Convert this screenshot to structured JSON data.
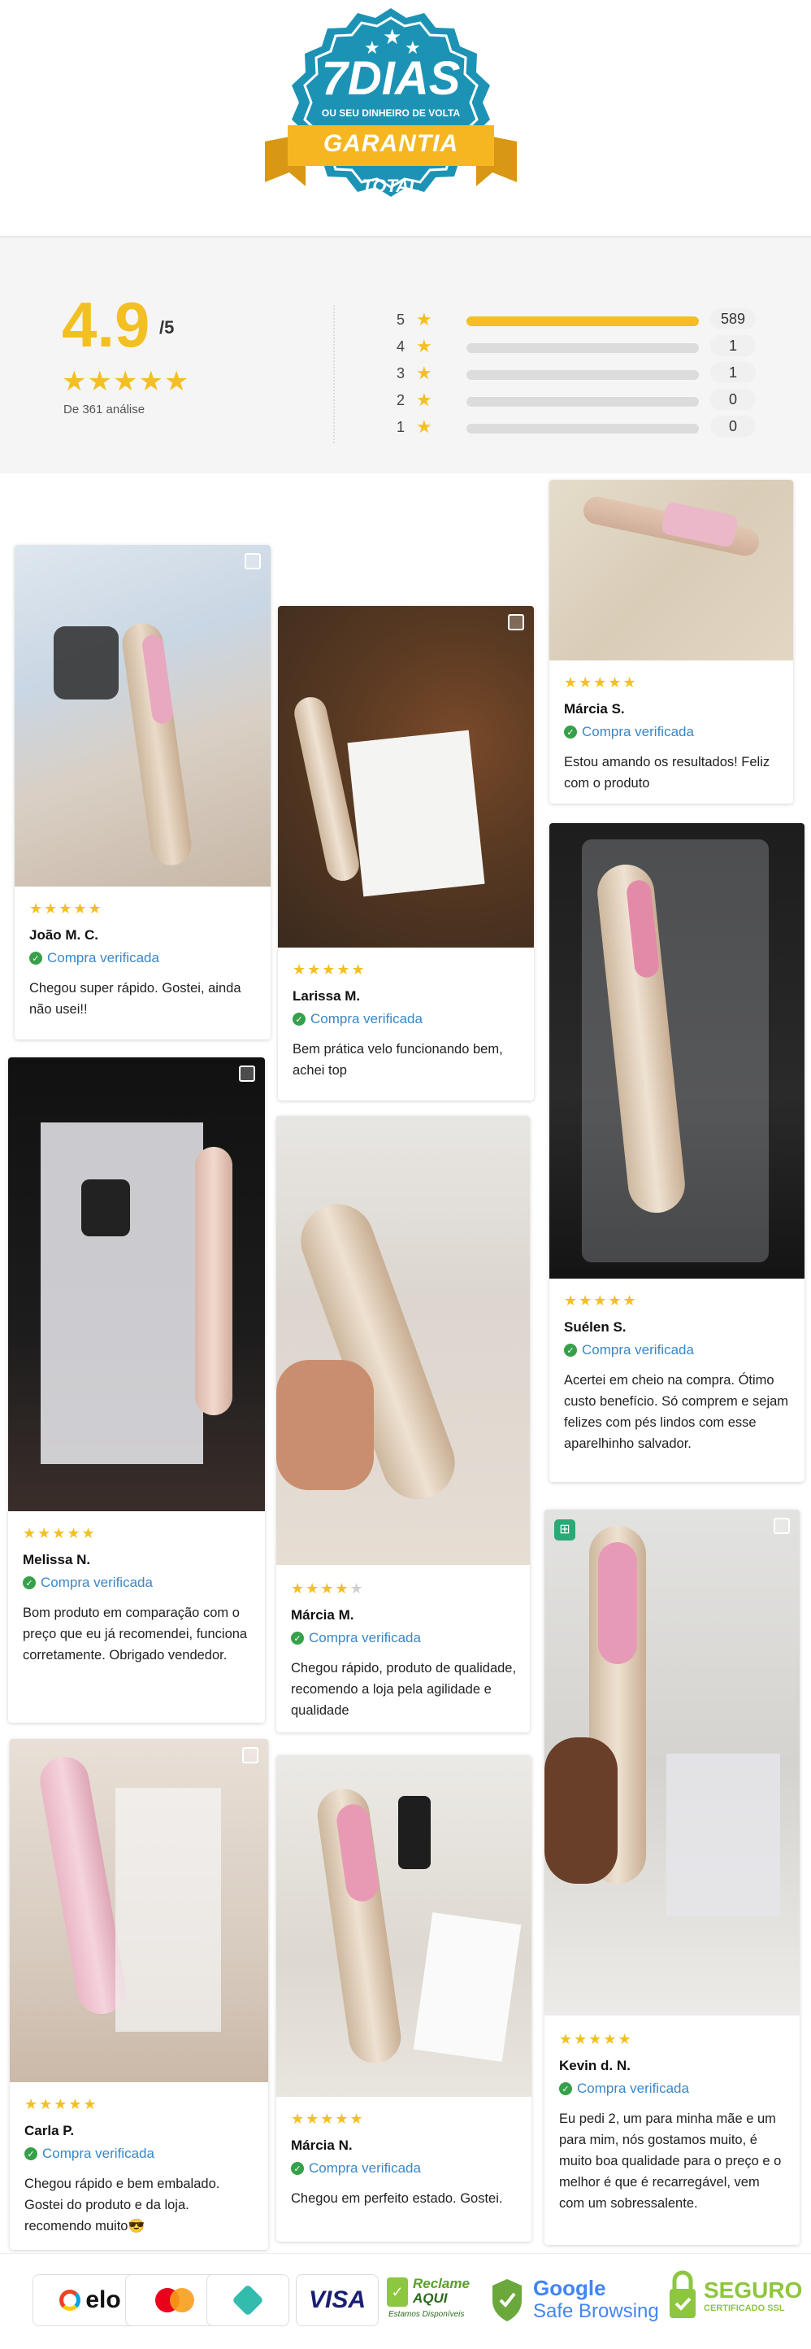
{
  "badge": {
    "big_text": "7DIAS",
    "line1": "OU SEU DINHEIRO DE VOLTA",
    "ribbon": "GARANTIA",
    "bottom": "TOTAL",
    "colors": {
      "blue": "#1c93b5",
      "yellow": "#f6b622"
    }
  },
  "summary": {
    "score": "4.9",
    "out_of": "/5",
    "stars": "★★★★★",
    "count_text": "De 361 análise",
    "rows": [
      {
        "label": "5",
        "count": "589",
        "fraction": 1.0
      },
      {
        "label": "4",
        "count": "1",
        "fraction": 0
      },
      {
        "label": "3",
        "count": "1",
        "fraction": 0
      },
      {
        "label": "2",
        "count": "0",
        "fraction": 0
      },
      {
        "label": "1",
        "count": "0",
        "fraction": 0
      }
    ]
  },
  "verified_label": "Compra verificada",
  "reviews": [
    {
      "name": "João M. C.",
      "stars": "★★★★★",
      "text": "Chegou super rápido. Gostei, ainda não usei!!"
    },
    {
      "name": "Larissa M.",
      "stars": "★★★★★",
      "text": "Bem prática velo funcionando bem, achei top"
    },
    {
      "name": "Márcia S.",
      "stars": "★★★★★",
      "text": "Estou amando os resultados! Feliz com o produto"
    },
    {
      "name": "Suélen S.",
      "stars": "★★★★★",
      "text": "Acertei em cheio na compra. Ótimo custo benefício. Só comprem e sejam felizes com pés lindos com esse aparelhinho salvador."
    },
    {
      "name": "Melissa N.",
      "stars": "★★★★★",
      "text": "Bom produto em comparação com o preço que eu já recomendei, funciona corretamente. Obrigado vendedor."
    },
    {
      "name": "Márcia M.",
      "stars": "★★★★",
      "stars_off": "★",
      "text": "Chegou rápido, produto de qualidade, recomendo a loja pela agilidade e qualidade"
    },
    {
      "name": "Kevin d. N.",
      "stars": "★★★★★",
      "text": "Eu pedi 2, um para minha mãe e um para mim, nós gostamos muito, é muito boa qualidade para o preço e o melhor é que é recarregável, vem com um sobressalente."
    },
    {
      "name": "Carla P.",
      "stars": "★★★★★",
      "text": "Chegou rápido e bem embalado. Gostei do produto e da loja. recomendo muito😎"
    },
    {
      "name": "Márcia N.",
      "stars": "★★★★★",
      "text": "Chegou em perfeito estado. Gostei."
    }
  ],
  "footer": {
    "elo": "elo",
    "visa": "VISA",
    "reclame_1": "Reclame",
    "reclame_2": "AQUI",
    "reclame_3": "Estamos Disponíveis",
    "google_1": "Google",
    "google_2": "Safe Browsing",
    "seguro_1": "SEGURO",
    "seguro_2": "CERTIFICADO SSL"
  }
}
